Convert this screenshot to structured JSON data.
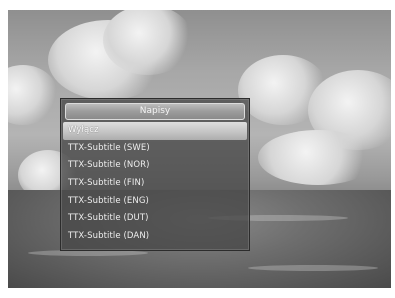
{
  "menu": {
    "title": "Napisy",
    "items": [
      {
        "label": "Wyłącz",
        "selected": true
      },
      {
        "label": "TTX-Subtitle (SWE)",
        "selected": false
      },
      {
        "label": "TTX-Subtitle (NOR)",
        "selected": false
      },
      {
        "label": "TTX-Subtitle (FIN)",
        "selected": false
      },
      {
        "label": "TTX-Subtitle (ENG)",
        "selected": false
      },
      {
        "label": "TTX-Subtitle (DUT)",
        "selected": false
      },
      {
        "label": "TTX-Subtitle (DAN)",
        "selected": false
      }
    ]
  },
  "colors": {
    "panel": "#464646",
    "highlight": "#c8c8c8",
    "text": "#eeeeee"
  }
}
